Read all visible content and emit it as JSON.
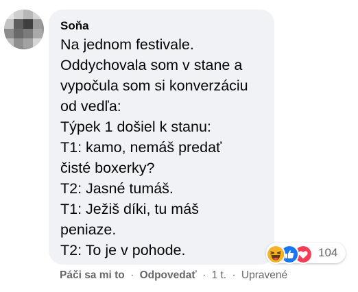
{
  "comment": {
    "author": "Soňa",
    "message_lines": [
      "Na jednom festivale.",
      "Oddychovala som v stane a",
      "vypočula som si konverzáciu",
      "od vedľa:",
      "Týpek 1 došiel k stanu:",
      "T1: kamo, nemáš predať",
      "čisté boxerky?",
      "T2: Jasné tumáš.",
      "T1: Ježiš díki, tu máš",
      "peniaze.",
      "T2: To je v pohode."
    ]
  },
  "reactions": {
    "icons": [
      "haha-icon",
      "like-icon",
      "love-icon"
    ],
    "count": "104",
    "colors": {
      "haha": "#f7b125",
      "like": "#1877f2",
      "love": "#f33e58"
    }
  },
  "actions": {
    "like_label": "Páči sa mi to",
    "reply_label": "Odpovedať",
    "separator": "·",
    "timestamp": "1 t.",
    "edited_label": "Upravené"
  }
}
